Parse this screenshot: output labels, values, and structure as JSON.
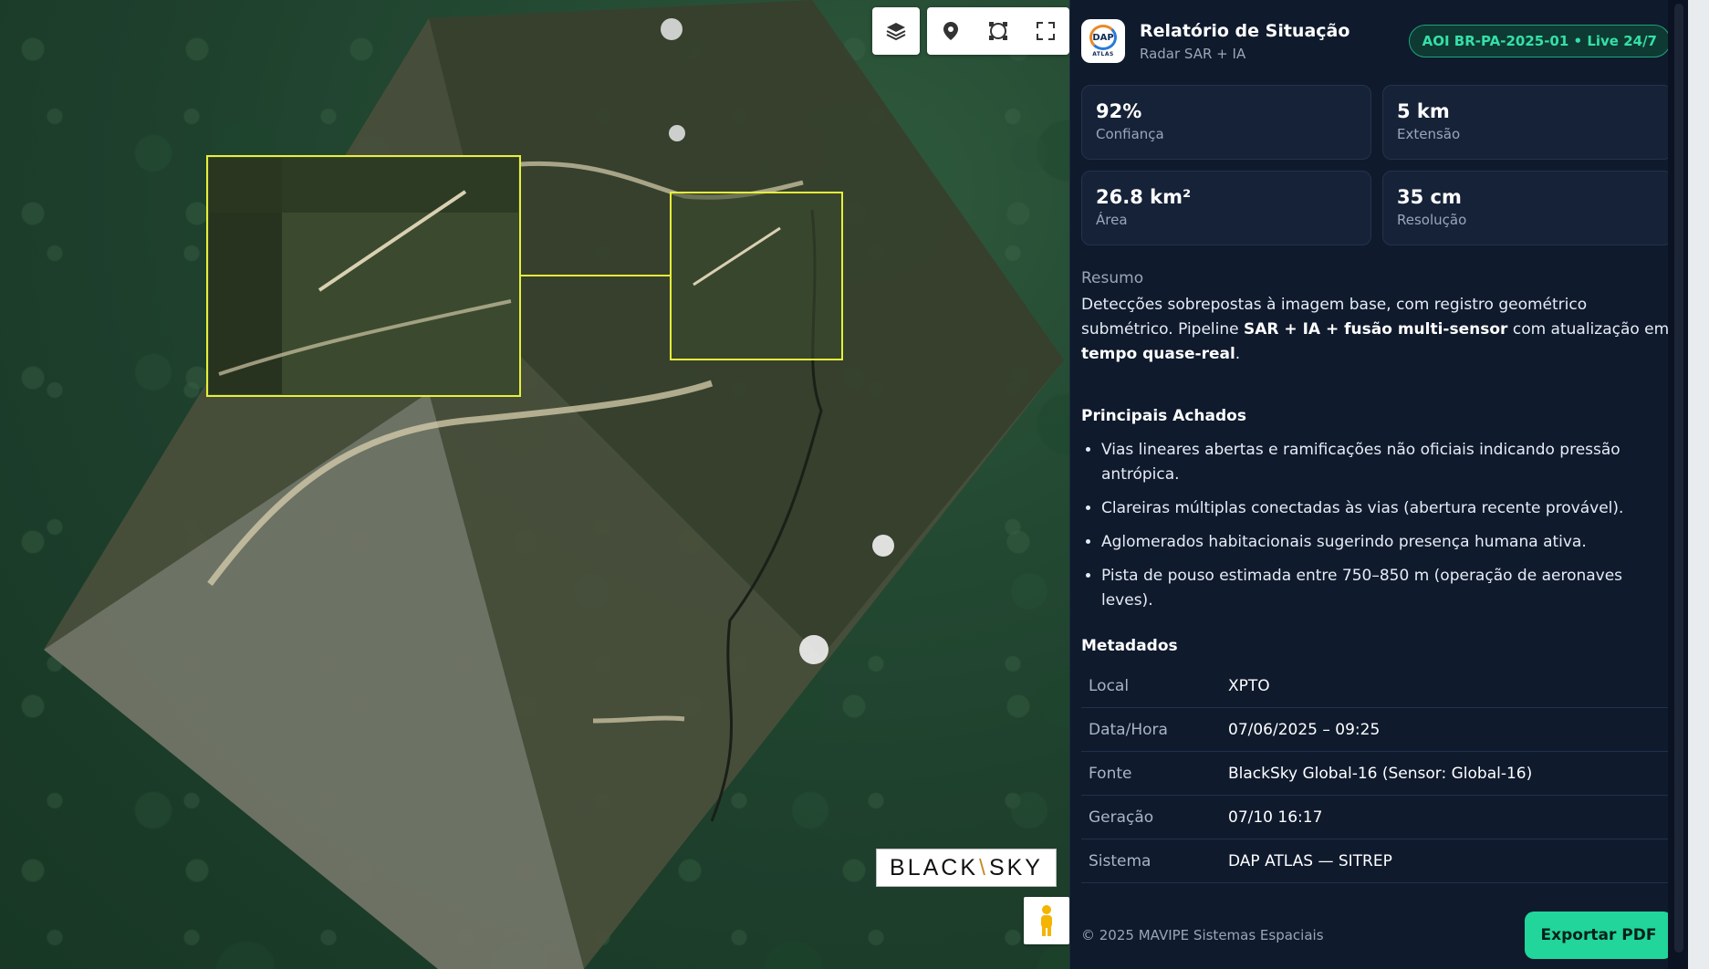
{
  "map": {
    "attribution_logo": "BLACK SKY",
    "controls": [
      "layers-icon",
      "map-pin-icon",
      "lasso-icon",
      "fullscreen-icon"
    ]
  },
  "panel": {
    "logo_text": "DAP",
    "logo_sub": "ATLAS",
    "title": "Relatório de Situação",
    "subtitle": "Radar SAR + IA",
    "aoi_badge": "AOI BR-PA-2025-01 • Live 24/7",
    "stats": [
      {
        "value": "92%",
        "label": "Confiança"
      },
      {
        "value": "5 km",
        "label": "Extensão"
      },
      {
        "value": "26.8 km²",
        "label": "Área"
      },
      {
        "value": "35 cm",
        "label": "Resolução"
      }
    ],
    "summary_label": "Resumo",
    "summary": {
      "p1": "Detecções sobrepostas à imagem base, com registro geométrico submétrico. Pipeline ",
      "b1": "SAR + IA + fusão multi-sensor",
      "p2": " com atualização em ",
      "b2": "tempo quase-real",
      "p3": "."
    },
    "findings_title": "Principais Achados",
    "findings": [
      "Vias lineares abertas e ramificações não oficiais indicando pressão antrópica.",
      "Clareiras múltiplas conectadas às vias (abertura recente provável).",
      "Aglomerados habitacionais sugerindo presença humana ativa.",
      "Pista de pouso estimada entre 750–850 m (operação de aeronaves leves)."
    ],
    "metadata_title": "Metadados",
    "metadata": [
      {
        "key": "Local",
        "value": "XPTO"
      },
      {
        "key": "Data/Hora",
        "value": "07/06/2025 – 09:25"
      },
      {
        "key": "Fonte",
        "value": "BlackSky Global-16 (Sensor: Global-16)"
      },
      {
        "key": "Geração",
        "value": "07/10 16:17"
      },
      {
        "key": "Sistema",
        "value": "DAP ATLAS — SITREP"
      }
    ],
    "copyright": "© 2025 MAVIPE Sistemas Espaciais",
    "export_label": "Exportar PDF"
  },
  "colors": {
    "accent": "#21d59b",
    "highlight_box": "#e6f03a",
    "panel_bg": "#0f1a2d"
  }
}
